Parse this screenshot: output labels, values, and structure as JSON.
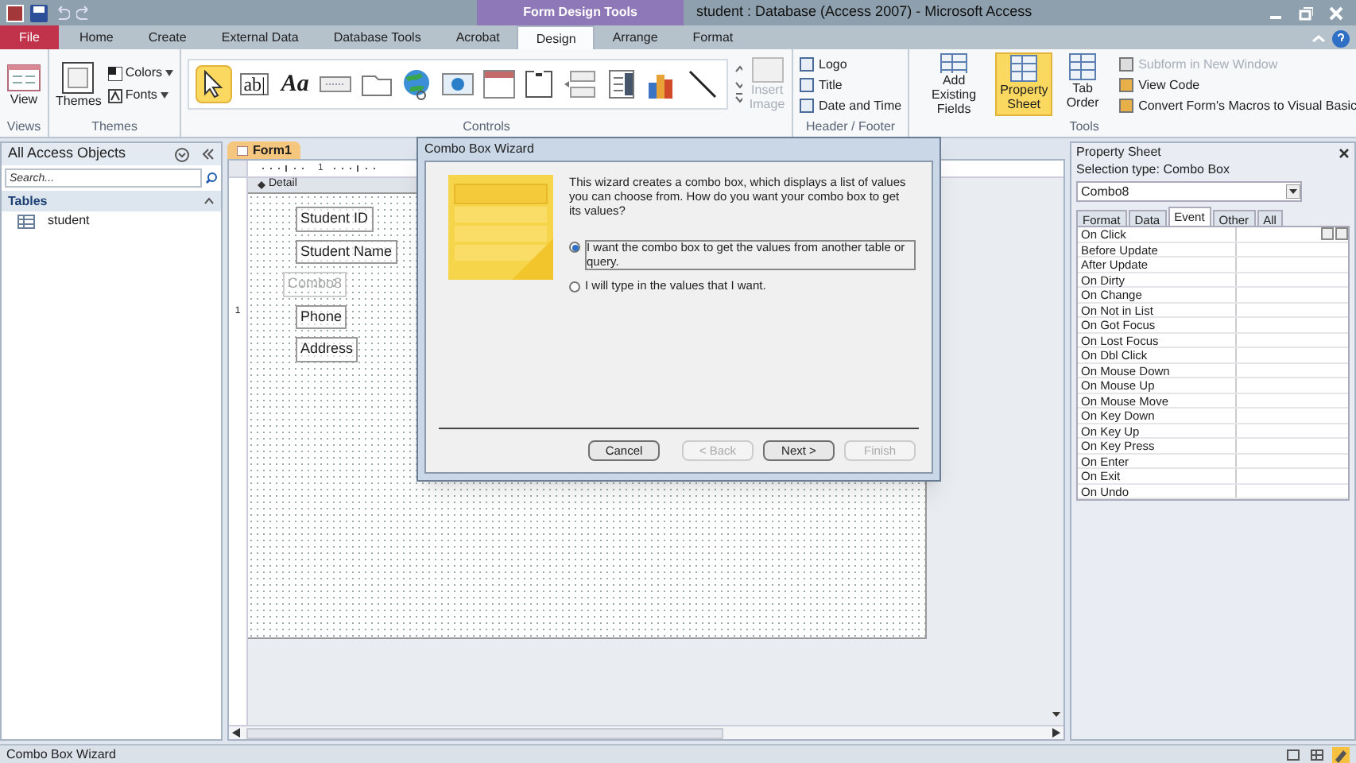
{
  "window": {
    "title": "student : Database (Access 2007)  -  Microsoft Access",
    "context_tab_group": "Form Design Tools"
  },
  "tabs": [
    {
      "label": "File",
      "kind": "file",
      "selected": false
    },
    {
      "label": "Home",
      "kind": "tab",
      "selected": false
    },
    {
      "label": "Create",
      "kind": "tab",
      "selected": false
    },
    {
      "label": "External Data",
      "kind": "tab",
      "selected": false
    },
    {
      "label": "Database Tools",
      "kind": "tab",
      "selected": false
    },
    {
      "label": "Acrobat",
      "kind": "tab",
      "selected": false
    },
    {
      "label": "Design",
      "kind": "tab",
      "selected": true
    },
    {
      "label": "Arrange",
      "kind": "tab",
      "selected": false
    },
    {
      "label": "Format",
      "kind": "tab",
      "selected": false
    }
  ],
  "ribbon": {
    "views": {
      "label": "Views",
      "view_button": "View"
    },
    "themes": {
      "label": "Themes",
      "themes_button": "Themes",
      "colors": "Colors",
      "fonts": "Fonts"
    },
    "controls": {
      "label": "Controls",
      "items": [
        {
          "kind": "pointer",
          "selected": true
        },
        {
          "kind": "textbox",
          "glyph": "ab|",
          "selected": false
        },
        {
          "kind": "label",
          "glyph": "Aa",
          "selected": false
        },
        {
          "kind": "button",
          "selected": false
        },
        {
          "kind": "tab",
          "selected": false
        },
        {
          "kind": "hyperlink",
          "selected": false
        },
        {
          "kind": "browser",
          "selected": false
        },
        {
          "kind": "navigation",
          "selected": false
        },
        {
          "kind": "group",
          "selected": false
        },
        {
          "kind": "pagebreak",
          "selected": false
        },
        {
          "kind": "combo",
          "selected": false
        },
        {
          "kind": "chart",
          "selected": false
        },
        {
          "kind": "line",
          "selected": false
        }
      ],
      "insert_image": {
        "label": "Insert Image",
        "disabled": true
      }
    },
    "header_footer": {
      "label": "Header / Footer",
      "items": [
        "Logo",
        "Title",
        "Date and Time"
      ]
    },
    "tools": {
      "label": "Tools",
      "big": [
        {
          "label": "Add Existing Fields",
          "kind": "fields",
          "selected": false
        },
        {
          "label": "Property Sheet",
          "kind": "sheet",
          "selected": true
        },
        {
          "label": "Tab Order",
          "kind": "order",
          "selected": false
        }
      ],
      "small": [
        {
          "label": "Subform in New Window",
          "disabled": true
        },
        {
          "label": "View Code",
          "disabled": false
        },
        {
          "label": "Convert Form's Macros to Visual Basic",
          "disabled": false
        }
      ]
    }
  },
  "nav_pane": {
    "title": "All Access Objects",
    "search": {
      "placeholder": "Search..."
    },
    "groups": [
      {
        "label": "Tables",
        "expanded": true,
        "items": [
          "student"
        ]
      }
    ]
  },
  "document": {
    "tab": "Form1",
    "ruler_mark": "1",
    "vertical_ruler_mark": "1",
    "section": "Detail",
    "fields": [
      {
        "label": "Student ID",
        "dimmed": false
      },
      {
        "label": "Student Name",
        "dimmed": false
      },
      {
        "label": "Combo8",
        "dimmed": true
      },
      {
        "label": "Phone",
        "dimmed": false
      },
      {
        "label": "Address",
        "dimmed": false
      }
    ]
  },
  "dialog": {
    "title": "Combo Box Wizard",
    "description": "This wizard creates a combo box, which displays a list of values you can choose from.  How do you want your combo box to get its values?",
    "options": [
      {
        "label": "I want the combo box to get the values from another table or query.",
        "selected": true
      },
      {
        "label": "I will type in the values that I want.",
        "selected": false
      }
    ],
    "buttons": [
      {
        "label": "Cancel",
        "disabled": false
      },
      {
        "label": "< Back",
        "disabled": true
      },
      {
        "label": "Next >",
        "disabled": false
      },
      {
        "label": "Finish",
        "disabled": true
      }
    ]
  },
  "property_sheet": {
    "title": "Property Sheet",
    "selection_type": "Selection type:  Combo Box",
    "object": "Combo8",
    "tabs": [
      {
        "label": "Format",
        "selected": false
      },
      {
        "label": "Data",
        "selected": false
      },
      {
        "label": "Event",
        "selected": true
      },
      {
        "label": "Other",
        "selected": false
      },
      {
        "label": "All",
        "selected": false
      }
    ],
    "rows": [
      "On Click",
      "Before Update",
      "After Update",
      "On Dirty",
      "On Change",
      "On Not in List",
      "On Got Focus",
      "On Lost Focus",
      "On Dbl Click",
      "On Mouse Down",
      "On Mouse Up",
      "On Mouse Move",
      "On Key Down",
      "On Key Up",
      "On Key Press",
      "On Enter",
      "On Exit",
      "On Undo"
    ]
  },
  "status_bar": {
    "text": "Combo Box Wizard",
    "views": [
      {
        "kind": "form",
        "selected": false
      },
      {
        "kind": "layout",
        "selected": false
      },
      {
        "kind": "design",
        "selected": true
      }
    ]
  }
}
